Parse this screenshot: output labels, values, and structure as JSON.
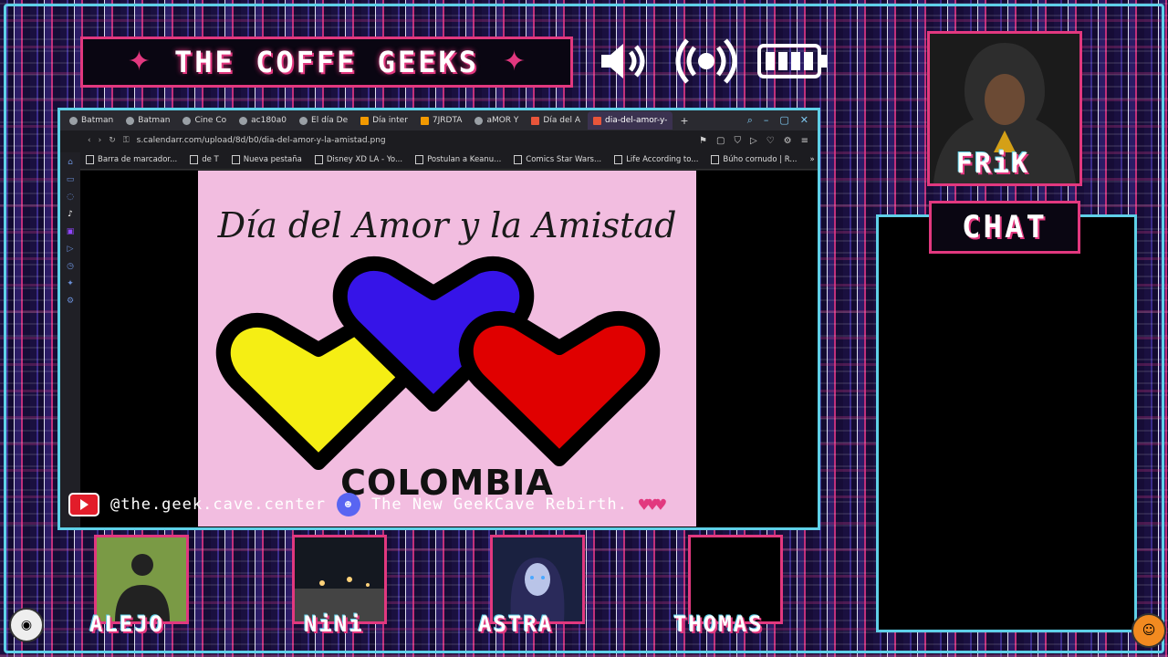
{
  "stream": {
    "title": "THE COFFE GEEKS",
    "host_label": "FRiK",
    "chat_label": "CHAT"
  },
  "status_icons": [
    "speaker-icon",
    "broadcast-icon",
    "battery-icon"
  ],
  "browser": {
    "tabs": [
      {
        "label": "Batman"
      },
      {
        "label": "Batman"
      },
      {
        "label": "Cine Co"
      },
      {
        "label": "ac180a0"
      },
      {
        "label": "El día De"
      },
      {
        "label": "Día inter"
      },
      {
        "label": "7JRDTA"
      },
      {
        "label": "aMOR Y"
      },
      {
        "label": "Día del A"
      },
      {
        "label": "dia-del-amor-y-",
        "active": true
      }
    ],
    "url": "s.calendarr.com/upload/8d/b0/dia-del-amor-y-la-amistad.png",
    "bookmarks": [
      "Barra de marcador...",
      "de T",
      "Nueva pestaña",
      "Disney XD LA - Yo...",
      "Postulan a Keanu...",
      "Comics Star Wars...",
      "Life According to...",
      "Búho cornudo | R..."
    ]
  },
  "image": {
    "title": "Día del Amor y la Amistad",
    "country": "COLOMBIA",
    "heart_colors": {
      "yellow": "#f5ee14",
      "blue": "#3614e8",
      "red": "#e00000"
    }
  },
  "socials": {
    "youtube": "@the.geek.cave.center",
    "discord": "The New GeekCave  Rebirth."
  },
  "guests": [
    {
      "name": "ALEJO"
    },
    {
      "name": "NiNi"
    },
    {
      "name": "ASTRA"
    },
    {
      "name": "THOMAS"
    }
  ],
  "colors": {
    "accent_pink": "#e2387f",
    "accent_cyan": "#5fd0e8"
  }
}
